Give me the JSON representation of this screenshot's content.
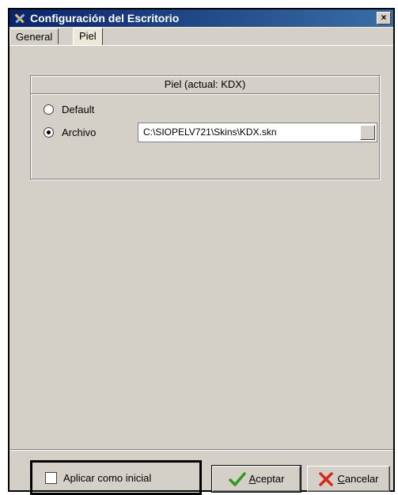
{
  "window": {
    "title": "Configuración del Escritorio",
    "close_label": "×"
  },
  "tabs": [
    {
      "label": "General",
      "active": false
    },
    {
      "label": "Piel",
      "active": true
    }
  ],
  "skin_group": {
    "header": "Piel (actual: KDX)",
    "options": [
      {
        "label": "Default",
        "checked": false
      },
      {
        "label": "Archivo",
        "checked": true
      }
    ],
    "file_path": "C:\\SIOPELV721\\Skins\\KDX.skn"
  },
  "footer": {
    "apply_initial_label": "Aplicar como inicial",
    "apply_initial_checked": false,
    "accept_label_first": "A",
    "accept_label_rest": "ceptar",
    "cancel_label_first": "C",
    "cancel_label_rest": "ancelar"
  },
  "icons": {
    "window_icon": "tools-icon",
    "accept_icon": "check-icon",
    "cancel_icon": "x-icon"
  },
  "colors": {
    "titlebar_start": "#0a246a",
    "titlebar_end": "#3a6ea5",
    "accept_icon": "#2e9b1a",
    "cancel_icon": "#d42a1a",
    "face": "#d4d0c8"
  }
}
